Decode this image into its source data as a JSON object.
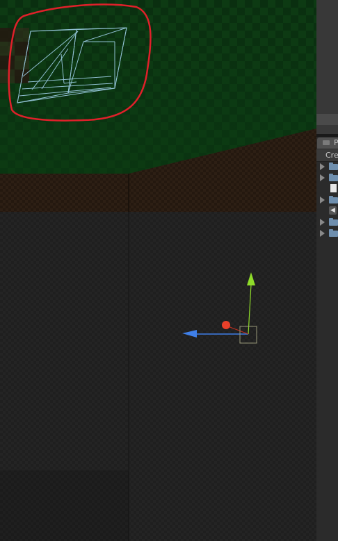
{
  "scene": {
    "name": "scene-view",
    "annotation_color": "#e0202a",
    "gizmo_colors": {
      "y_axis": "#8fdc2a",
      "x_axis": "#3f7fe8",
      "z_axis": "#e8402a",
      "frustum": "#9fd0e8"
    },
    "floor_colors": [
      "#0b3a12",
      "#2a1c12",
      "#232323"
    ]
  },
  "project_panel": {
    "title": "P",
    "create_label": "Cre",
    "items": [
      {
        "kind": "folder",
        "icon": "folder-icon",
        "expandable": true
      },
      {
        "kind": "folder",
        "icon": "folder-icon",
        "expandable": true
      },
      {
        "kind": "file",
        "icon": "document-icon",
        "expandable": false
      },
      {
        "kind": "folder",
        "icon": "folder-icon",
        "expandable": true
      },
      {
        "kind": "scene",
        "icon": "unity-scene-icon",
        "expandable": false
      },
      {
        "kind": "folder",
        "icon": "folder-icon",
        "expandable": true
      },
      {
        "kind": "folder",
        "icon": "folder-icon",
        "expandable": true
      }
    ]
  }
}
